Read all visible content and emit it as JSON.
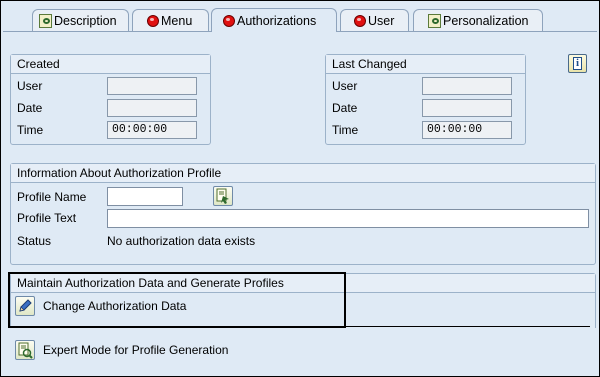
{
  "tabs": [
    {
      "label": "Description",
      "icon": "description-icon",
      "active": false
    },
    {
      "label": "Menu",
      "icon": "status-red-icon",
      "active": false
    },
    {
      "label": "Authorizations",
      "icon": "status-red-icon",
      "active": true
    },
    {
      "label": "User",
      "icon": "status-red-icon",
      "active": false
    },
    {
      "label": "Personalization",
      "icon": "personalization-icon",
      "active": false
    }
  ],
  "created": {
    "title": "Created",
    "user_label": "User",
    "user_value": "",
    "date_label": "Date",
    "date_value": "",
    "time_label": "Time",
    "time_value": "00:00:00"
  },
  "last_changed": {
    "title": "Last Changed",
    "user_label": "User",
    "user_value": "",
    "date_label": "Date",
    "date_value": "",
    "time_label": "Time",
    "time_value": "00:00:00"
  },
  "profile_info": {
    "title": "Information About Authorization Profile",
    "name_label": "Profile Name",
    "name_value": "",
    "text_label": "Profile Text",
    "text_value": "",
    "status_label": "Status",
    "status_value": "No authorization data exists"
  },
  "maintain": {
    "title": "Maintain Authorization Data and Generate Profiles",
    "change_label": "Change Authorization Data"
  },
  "expert": {
    "label": "Expert Mode for Profile Generation"
  },
  "colors": {
    "background": "#dfeaf5",
    "status_red": "#e01010",
    "group_border": "#9cb2c9"
  }
}
